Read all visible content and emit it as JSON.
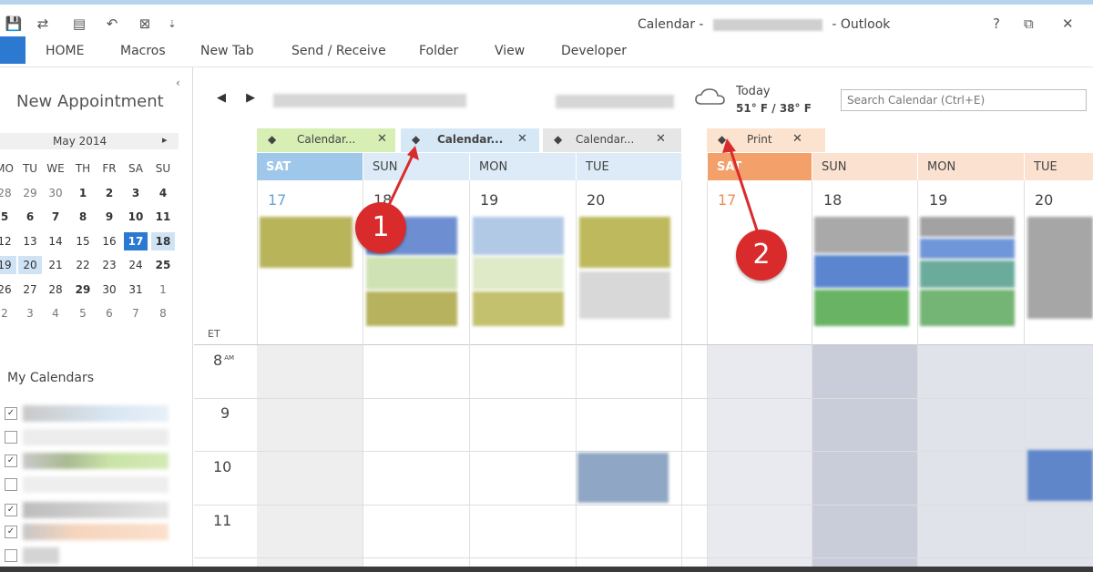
{
  "window": {
    "title_prefix": "Calendar - ",
    "title_suffix": " - Outlook",
    "help": "?",
    "restore": "⧉",
    "close": "✕"
  },
  "quick_access": {
    "save_icon": "💾",
    "send_receive_icon": "⇄",
    "calendar_icon": "▤",
    "undo_icon": "↶",
    "touch_icon": "⊠",
    "customize": "⇣"
  },
  "ribbon": {
    "tabs": [
      "HOME",
      "Macros",
      "New Tab",
      "Send / Receive",
      "Folder",
      "View",
      "Developer"
    ]
  },
  "left": {
    "new_appointment": "New Appointment",
    "collapse": "‹",
    "month": "May 2014",
    "next": "▸",
    "dow": [
      "MO",
      "TU",
      "WE",
      "TH",
      "FR",
      "SA",
      "SU"
    ],
    "weeks": [
      [
        "28",
        "29",
        "30",
        "1",
        "2",
        "3",
        "4"
      ],
      [
        "5",
        "6",
        "7",
        "8",
        "9",
        "10",
        "11"
      ],
      [
        "12",
        "13",
        "14",
        "15",
        "16",
        "17",
        "18"
      ],
      [
        "19",
        "20",
        "21",
        "22",
        "23",
        "24",
        "25"
      ],
      [
        "26",
        "27",
        "28",
        "29",
        "30",
        "31",
        "1"
      ],
      [
        "2",
        "3",
        "4",
        "5",
        "6",
        "7",
        "8"
      ]
    ],
    "my_calendars": "My Calendars",
    "check": "✓"
  },
  "calendar": {
    "prev": "◀",
    "next": "▶",
    "today_label": "Today",
    "today_temp": "51° F / 38° F",
    "search_placeholder": "Search Calendar (Ctrl+E)",
    "tabs": [
      {
        "label": "Calendar...",
        "close": "✕"
      },
      {
        "label": "Calendar...",
        "close": "✕"
      },
      {
        "label": "Calendar...",
        "close": "✕"
      },
      {
        "label": "Print",
        "close": "✕"
      }
    ],
    "tab_arrow": "◆",
    "days_left": [
      "SAT",
      "SUN",
      "MON",
      "TUE"
    ],
    "dates_left": [
      "17",
      "18",
      "19",
      "20"
    ],
    "days_right": [
      "SAT",
      "SUN",
      "MON",
      "TUE"
    ],
    "dates_right": [
      "17",
      "18",
      "19",
      "20"
    ],
    "timezone": "ET",
    "hours": [
      "8",
      "9",
      "10",
      "11"
    ],
    "am": "AM"
  },
  "annotations": {
    "one": "1",
    "two": "2"
  },
  "colors": {
    "accent": "#2b79d0",
    "callout": "#d92b2b",
    "tab_green": "#d7eeb5",
    "tab_blue": "#d6e8f6",
    "tab_orange": "#fce3d0",
    "sat_blue": "#9ec7ea",
    "sat_orange": "#f3a06a"
  }
}
